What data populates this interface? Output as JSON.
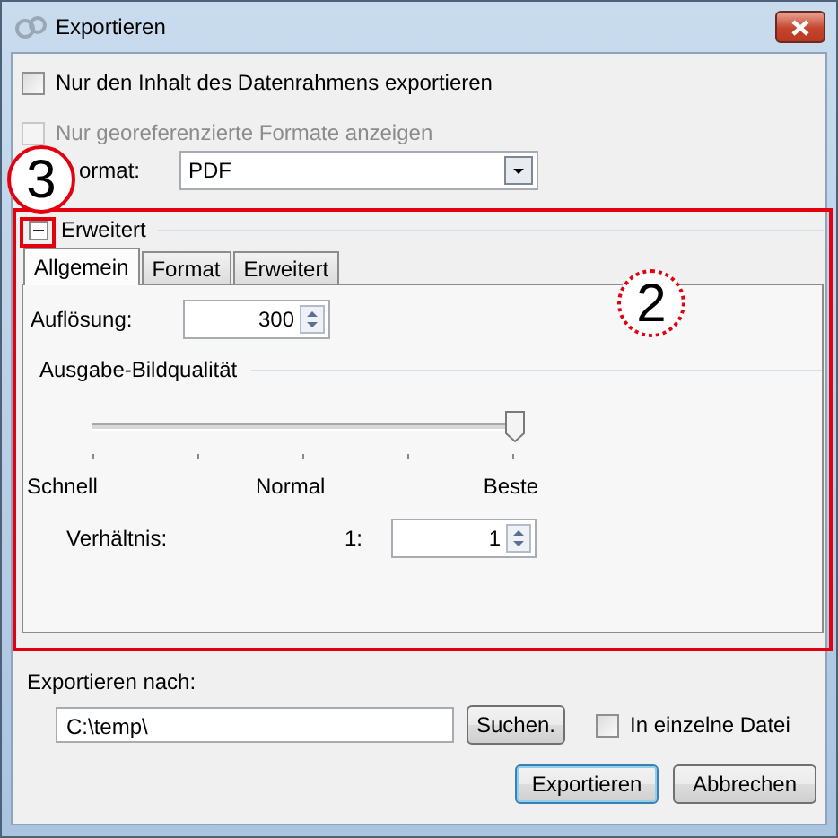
{
  "window": {
    "title": "Exportieren"
  },
  "options": [
    {
      "label": "Nur den Inhalt des Datenrahmens exportieren",
      "checked": false,
      "disabled": false
    },
    {
      "label": "Nur georeferenzierte Formate anzeigen",
      "checked": false,
      "disabled": true
    }
  ],
  "format": {
    "label": "ormat:",
    "value": "PDF"
  },
  "advanced": {
    "label": "Erweitert",
    "expanded": true,
    "tabs": [
      {
        "label": "Allgemein",
        "selected": true
      },
      {
        "label": "Format",
        "selected": false
      },
      {
        "label": "Erweitert",
        "selected": false
      }
    ],
    "resolution": {
      "label": "Auflösung:",
      "value": "300"
    },
    "quality": {
      "title": "Ausgabe-Bildqualität",
      "level": 1,
      "labels": [
        "Schnell",
        "Normal",
        "Beste"
      ]
    },
    "ratio": {
      "label": "Verhältnis:",
      "prefix": "1:",
      "value": "1"
    }
  },
  "export": {
    "label": "Exportieren nach:",
    "path": "C:\\temp\\",
    "browse": "Suchen.",
    "single_file": {
      "label": "In einzelne Datei",
      "checked": false
    }
  },
  "buttons": [
    {
      "label": "Exportieren",
      "default": true
    },
    {
      "label": "Abbrechen",
      "default": false
    }
  ],
  "annotations": [
    {
      "label": "3"
    },
    {
      "label": "2"
    }
  ]
}
